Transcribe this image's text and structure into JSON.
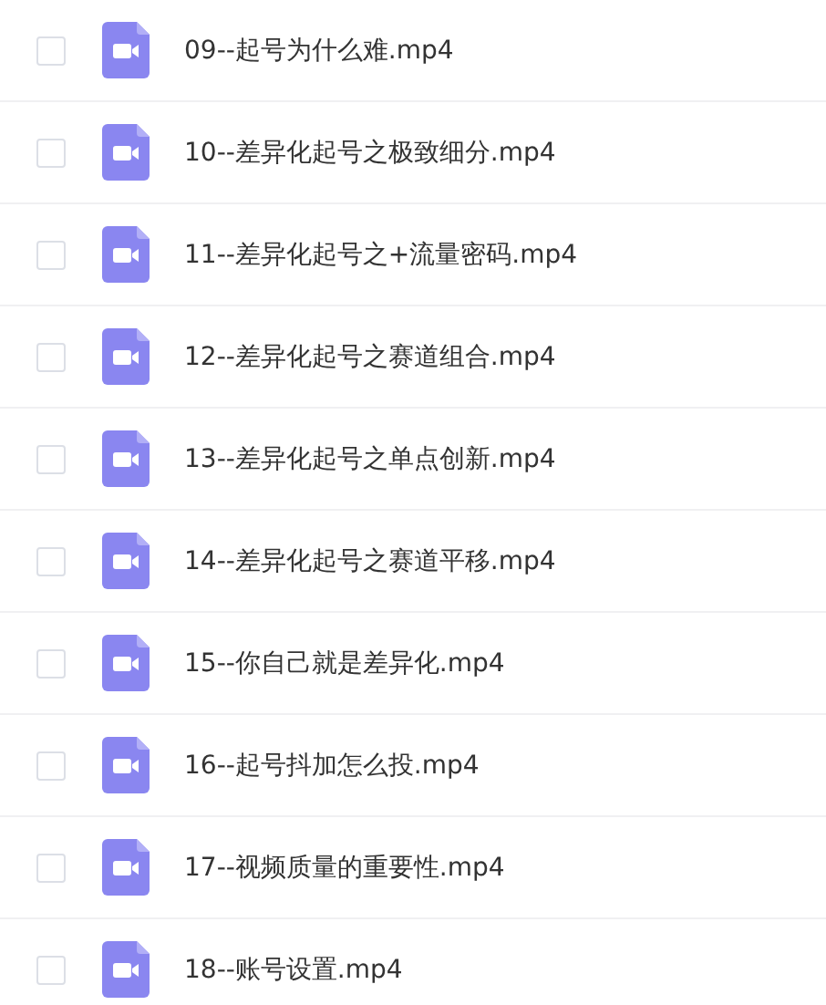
{
  "files": [
    {
      "name": "09--起号为什么难.mp4",
      "checked": false
    },
    {
      "name": "10--差异化起号之极致细分.mp4",
      "checked": false
    },
    {
      "name": "11--差异化起号之+流量密码.mp4",
      "checked": false
    },
    {
      "name": "12--差异化起号之赛道组合.mp4",
      "checked": false
    },
    {
      "name": "13--差异化起号之单点创新.mp4",
      "checked": false
    },
    {
      "name": "14--差异化起号之赛道平移.mp4",
      "checked": false
    },
    {
      "name": "15--你自己就是差异化.mp4",
      "checked": false
    },
    {
      "name": "16--起号抖加怎么投.mp4",
      "checked": false
    },
    {
      "name": "17--视频质量的重要性.mp4",
      "checked": false
    },
    {
      "name": "18--账号设置.mp4",
      "checked": false
    }
  ]
}
